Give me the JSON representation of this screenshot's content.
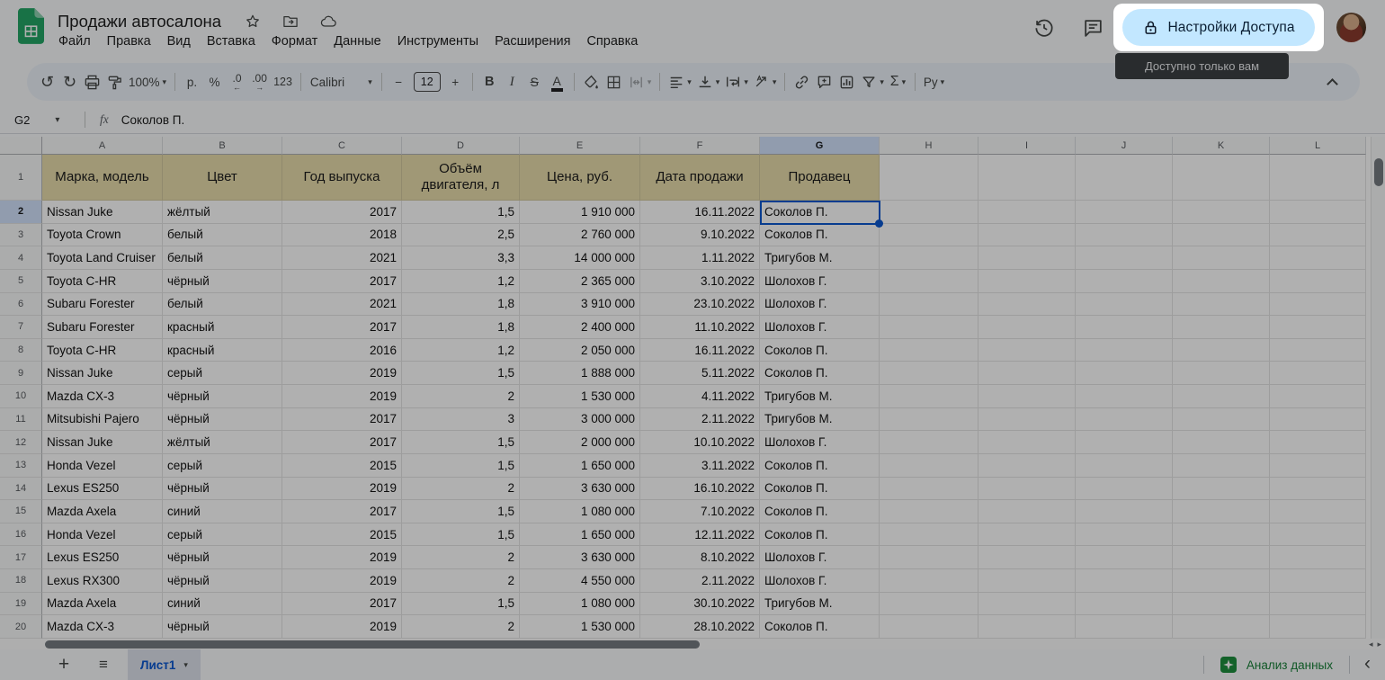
{
  "topbar": {
    "title": "Продажи автосалона",
    "menus": [
      "Файл",
      "Правка",
      "Вид",
      "Вставка",
      "Формат",
      "Данные",
      "Инструменты",
      "Расширения",
      "Справка"
    ],
    "share_button_label": "Настройки Доступа",
    "tooltip": "Доступно только вам"
  },
  "toolbar": {
    "zoom_value": "100%",
    "currency_label": "р.",
    "percent_label": "%",
    "decrease_decimals_label": ".0",
    "increase_decimals_label": ".00",
    "number_format_label": "123",
    "font_name": "Calibri",
    "font_size": "12",
    "minus_label": "−",
    "plus_label": "+",
    "bold_label": "B",
    "italic_label": "I",
    "strikethrough_label": "S",
    "text_color_label": "A",
    "functions_label": "Σ",
    "input_tools_label": "Ру"
  },
  "formula_bar": {
    "cell_reference": "G2",
    "fx_label": "fx",
    "value": "Соколов П."
  },
  "grid": {
    "selected_cell": "G2",
    "selected_column": "G",
    "selected_row": "2",
    "column_letters": [
      "A",
      "B",
      "C",
      "D",
      "E",
      "F",
      "G",
      "H",
      "I",
      "J",
      "K",
      "L"
    ],
    "header_row_num": "1",
    "header_row": [
      "Марка, модель",
      "Цвет",
      "Год выпуска",
      "Объём двигателя, л",
      "Цена, руб.",
      "Дата продажи",
      "Продавец"
    ],
    "rows": [
      {
        "num": "2",
        "cells": [
          "Nissan Juke",
          "жёлтый",
          "2017",
          "1,5",
          "1 910 000",
          "16.11.2022",
          "Соколов П."
        ]
      },
      {
        "num": "3",
        "cells": [
          "Toyota Crown",
          "белый",
          "2018",
          "2,5",
          "2 760 000",
          "9.10.2022",
          "Соколов П."
        ]
      },
      {
        "num": "4",
        "cells": [
          "Toyota Land Cruiser",
          "белый",
          "2021",
          "3,3",
          "14 000 000",
          "1.11.2022",
          "Тригубов М."
        ]
      },
      {
        "num": "5",
        "cells": [
          "Toyota C-HR",
          "чёрный",
          "2017",
          "1,2",
          "2 365 000",
          "3.10.2022",
          "Шолохов Г."
        ]
      },
      {
        "num": "6",
        "cells": [
          "Subaru Forester",
          "белый",
          "2021",
          "1,8",
          "3 910 000",
          "23.10.2022",
          "Шолохов Г."
        ]
      },
      {
        "num": "7",
        "cells": [
          "Subaru Forester",
          "красный",
          "2017",
          "1,8",
          "2 400 000",
          "11.10.2022",
          "Шолохов Г."
        ]
      },
      {
        "num": "8",
        "cells": [
          "Toyota C-HR",
          "красный",
          "2016",
          "1,2",
          "2 050 000",
          "16.11.2022",
          "Соколов П."
        ]
      },
      {
        "num": "9",
        "cells": [
          "Nissan Juke",
          "серый",
          "2019",
          "1,5",
          "1 888 000",
          "5.11.2022",
          "Соколов П."
        ]
      },
      {
        "num": "10",
        "cells": [
          "Mazda CX-3",
          "чёрный",
          "2019",
          "2",
          "1 530 000",
          "4.11.2022",
          "Тригубов М."
        ]
      },
      {
        "num": "11",
        "cells": [
          "Mitsubishi Pajero",
          "чёрный",
          "2017",
          "3",
          "3 000 000",
          "2.11.2022",
          "Тригубов М."
        ]
      },
      {
        "num": "12",
        "cells": [
          "Nissan Juke",
          "жёлтый",
          "2017",
          "1,5",
          "2 000 000",
          "10.10.2022",
          "Шолохов Г."
        ]
      },
      {
        "num": "13",
        "cells": [
          "Honda Vezel",
          "серый",
          "2015",
          "1,5",
          "1 650 000",
          "3.11.2022",
          "Соколов П."
        ]
      },
      {
        "num": "14",
        "cells": [
          "Lexus ES250",
          "чёрный",
          "2019",
          "2",
          "3 630 000",
          "16.10.2022",
          "Соколов П."
        ]
      },
      {
        "num": "15",
        "cells": [
          "Mazda Axela",
          "синий",
          "2017",
          "1,5",
          "1 080 000",
          "7.10.2022",
          "Соколов П."
        ]
      },
      {
        "num": "16",
        "cells": [
          "Honda Vezel",
          "серый",
          "2015",
          "1,5",
          "1 650 000",
          "12.11.2022",
          "Соколов П."
        ]
      },
      {
        "num": "17",
        "cells": [
          "Lexus ES250",
          "чёрный",
          "2019",
          "2",
          "3 630 000",
          "8.10.2022",
          "Шолохов Г."
        ]
      },
      {
        "num": "18",
        "cells": [
          "Lexus RX300",
          "чёрный",
          "2019",
          "2",
          "4 550 000",
          "2.11.2022",
          "Шолохов Г."
        ]
      },
      {
        "num": "19",
        "cells": [
          "Mazda Axela",
          "синий",
          "2017",
          "1,5",
          "1 080 000",
          "30.10.2022",
          "Тригубов М."
        ]
      },
      {
        "num": "20",
        "cells": [
          "Mazda CX-3",
          "чёрный",
          "2019",
          "2",
          "1 530 000",
          "28.10.2022",
          "Соколов П."
        ]
      }
    ]
  },
  "bottombar": {
    "sheet_tab_label": "Лист1",
    "explore_label": "Анализ данных"
  },
  "icons": {
    "undo": "↺",
    "redo": "↻",
    "caret_down": "▾",
    "dec_arrow_left": "←",
    "dec_arrow_right": "→",
    "add_sheet": "+",
    "all_sheets": "≡",
    "back_chevron": "‹",
    "scroll_left": "◂",
    "scroll_right": "▸"
  },
  "colors": {
    "header_row_bg": "#e8dcab",
    "selection_blue": "#0b57d0",
    "share_button_bg": "#c2e7ff",
    "explore_green": "#188038",
    "tooltip_bg": "#3c4043"
  }
}
